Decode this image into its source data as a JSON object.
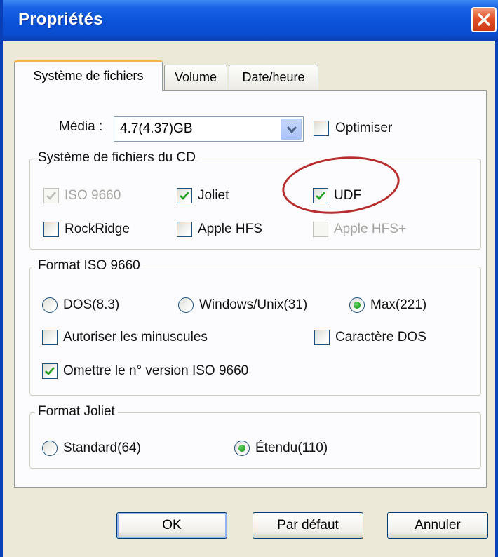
{
  "window": {
    "title": "Propriétés"
  },
  "tabs": [
    {
      "label": "Système de fichiers",
      "active": true
    },
    {
      "label": "Volume",
      "active": false
    },
    {
      "label": "Date/heure",
      "active": false
    }
  ],
  "media": {
    "label": "Média :",
    "value": "4.7(4.37)GB",
    "optimize_label": "Optimiser",
    "optimize_checked": false
  },
  "cd_filesystem": {
    "title": "Système de fichiers du CD",
    "options": [
      {
        "label": "ISO 9660",
        "checked": true,
        "enabled": false
      },
      {
        "label": "Joliet",
        "checked": true,
        "enabled": true
      },
      {
        "label": "UDF",
        "checked": true,
        "enabled": true
      },
      {
        "label": "RockRidge",
        "checked": false,
        "enabled": true
      },
      {
        "label": "Apple HFS",
        "checked": false,
        "enabled": true
      },
      {
        "label": "Apple HFS+",
        "checked": false,
        "enabled": false
      }
    ]
  },
  "iso_format": {
    "title": "Format ISO 9660",
    "radios": [
      {
        "label": "DOS(8.3)",
        "selected": false
      },
      {
        "label": "Windows/Unix(31)",
        "selected": false
      },
      {
        "label": "Max(221)",
        "selected": true
      }
    ],
    "allow_lowercase": {
      "label": "Autoriser les minuscules",
      "checked": false
    },
    "dos_chars": {
      "label": "Caractère DOS",
      "checked": false
    },
    "omit_version": {
      "label": "Omettre le n° version ISO 9660",
      "checked": true
    }
  },
  "joliet_format": {
    "title": "Format Joliet",
    "radios": [
      {
        "label": "Standard(64)",
        "selected": false
      },
      {
        "label": "Étendu(110)",
        "selected": true
      }
    ]
  },
  "buttons": {
    "ok": "OK",
    "default": "Par défaut",
    "cancel": "Annuler"
  },
  "colors": {
    "titlebar": "#0a52d8",
    "panel": "#fcfcfe",
    "check_green": "#21a121",
    "annotation_red": "#b82d2d"
  },
  "icons": {
    "close": "close-icon",
    "dropdown": "chevron-down-icon",
    "check": "check-icon"
  }
}
